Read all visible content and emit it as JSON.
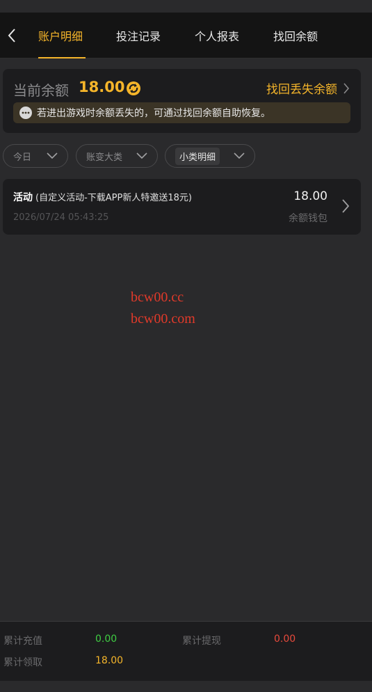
{
  "nav": {
    "tabs": [
      {
        "label": "账户明细",
        "active": true
      },
      {
        "label": "投注记录",
        "active": false
      },
      {
        "label": "个人报表",
        "active": false
      },
      {
        "label": "找回余额",
        "active": false
      }
    ]
  },
  "balance": {
    "label": "当前余额",
    "value": "18.00",
    "recover_label": "找回丢失余额",
    "notice": "若进出游戏时余额丢失的，可通过找回余额自助恢复。"
  },
  "filters": [
    {
      "value": "今日"
    },
    {
      "value": "账变大类"
    },
    {
      "value": "小类明细"
    }
  ],
  "records": [
    {
      "type": "活动",
      "detail": "(自定义活动-下载APP新人特邀送18元)",
      "datetime": "2026/07/24 05:43:25",
      "amount": "18.00",
      "wallet": "余额钱包"
    }
  ],
  "watermark": [
    "bcw00.cc",
    "bcw00.com"
  ],
  "summary": {
    "deposit_label": "累计充值",
    "deposit_value": "0.00",
    "withdraw_label": "累计提现",
    "withdraw_value": "0.00",
    "claimed_label": "累计领取",
    "claimed_value": "18.00"
  },
  "colors": {
    "accent": "#f5b52a",
    "deposit": "#3fce43",
    "withdraw": "#e84a3c",
    "watermark": "#e23a2a"
  }
}
